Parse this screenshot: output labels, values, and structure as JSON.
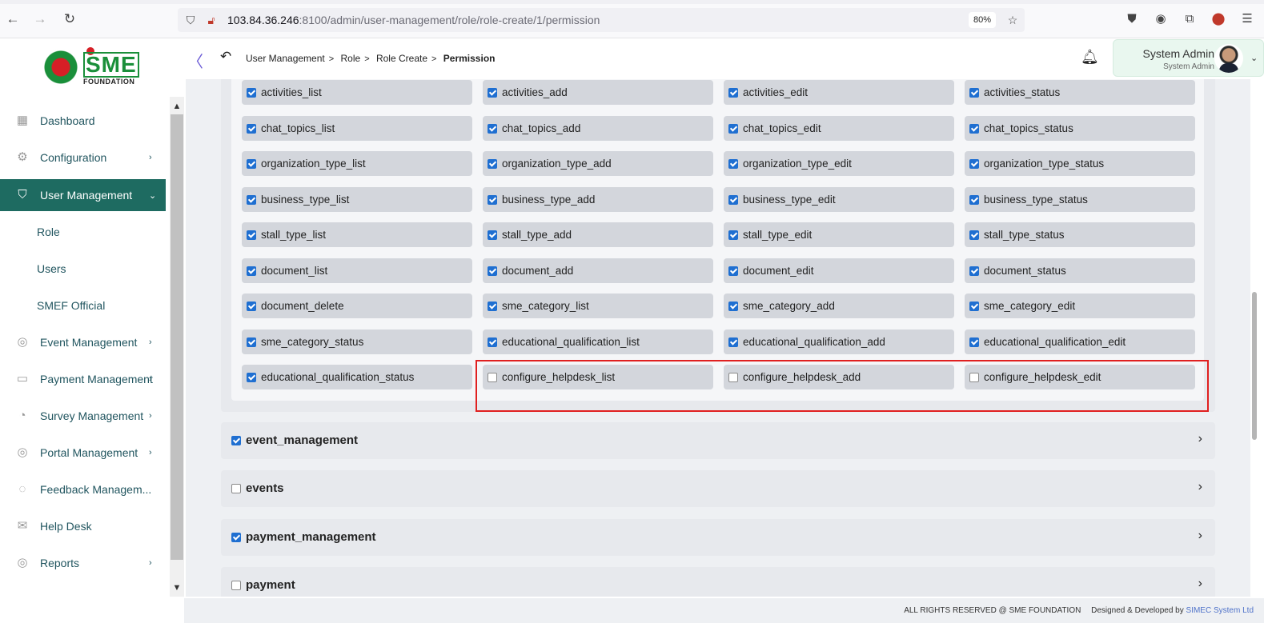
{
  "browser": {
    "url_main": "103.84.36.246",
    "url_rest": ":8100/admin/user-management/role/role-create/1/permission",
    "zoom": "80%"
  },
  "logo": {
    "sme": "SME",
    "foundation": "FOUNDATION"
  },
  "breadcrumb": [
    "User Management",
    "Role",
    "Role Create",
    "Permission"
  ],
  "user": {
    "name": "System Admin",
    "role": "System Admin"
  },
  "sidebar": {
    "items": [
      {
        "label": "Dashboard",
        "icon": "grid-icon"
      },
      {
        "label": "Configuration",
        "icon": "config-icon"
      },
      {
        "label": "User Management",
        "icon": "shield-icon",
        "active": true
      },
      {
        "label": "Event Management",
        "icon": "lock-icon"
      },
      {
        "label": "Payment Management",
        "icon": "payment-icon"
      },
      {
        "label": "Survey Management",
        "icon": "pie-icon"
      },
      {
        "label": "Portal Management",
        "icon": "lock-icon"
      },
      {
        "label": "Feedback Managem...",
        "icon": "feedback-icon"
      },
      {
        "label": "Help Desk",
        "icon": "mail-icon"
      },
      {
        "label": "Reports",
        "icon": "lock-icon"
      }
    ],
    "subitems": [
      "Role",
      "Users",
      "SMEF Official"
    ]
  },
  "permissions": [
    [
      "activities_list",
      "activities_add",
      "activities_edit",
      "activities_status"
    ],
    [
      "chat_topics_list",
      "chat_topics_add",
      "chat_topics_edit",
      "chat_topics_status"
    ],
    [
      "organization_type_list",
      "organization_type_add",
      "organization_type_edit",
      "organization_type_status"
    ],
    [
      "business_type_list",
      "business_type_add",
      "business_type_edit",
      "business_type_status"
    ],
    [
      "stall_type_list",
      "stall_type_add",
      "stall_type_edit",
      "stall_type_status"
    ],
    [
      "document_list",
      "document_add",
      "document_edit",
      "document_status"
    ],
    [
      "document_delete",
      "sme_category_list",
      "sme_category_add",
      "sme_category_edit"
    ],
    [
      "sme_category_status",
      "educational_qualification_list",
      "educational_qualification_add",
      "educational_qualification_edit"
    ],
    [
      "educational_qualification_status",
      "configure_helpdesk_list",
      "configure_helpdesk_add",
      "configure_helpdesk_edit"
    ]
  ],
  "sections": [
    {
      "label": "event_management",
      "checked": true
    },
    {
      "label": "events",
      "checked": false
    },
    {
      "label": "payment_management",
      "checked": true
    },
    {
      "label": "payment",
      "checked": false
    }
  ],
  "footer": {
    "rights": "ALL RIGHTS RESERVED @ SME FOUNDATION",
    "designed": "Designed & Developed by",
    "company": "SIMEC System Ltd"
  }
}
